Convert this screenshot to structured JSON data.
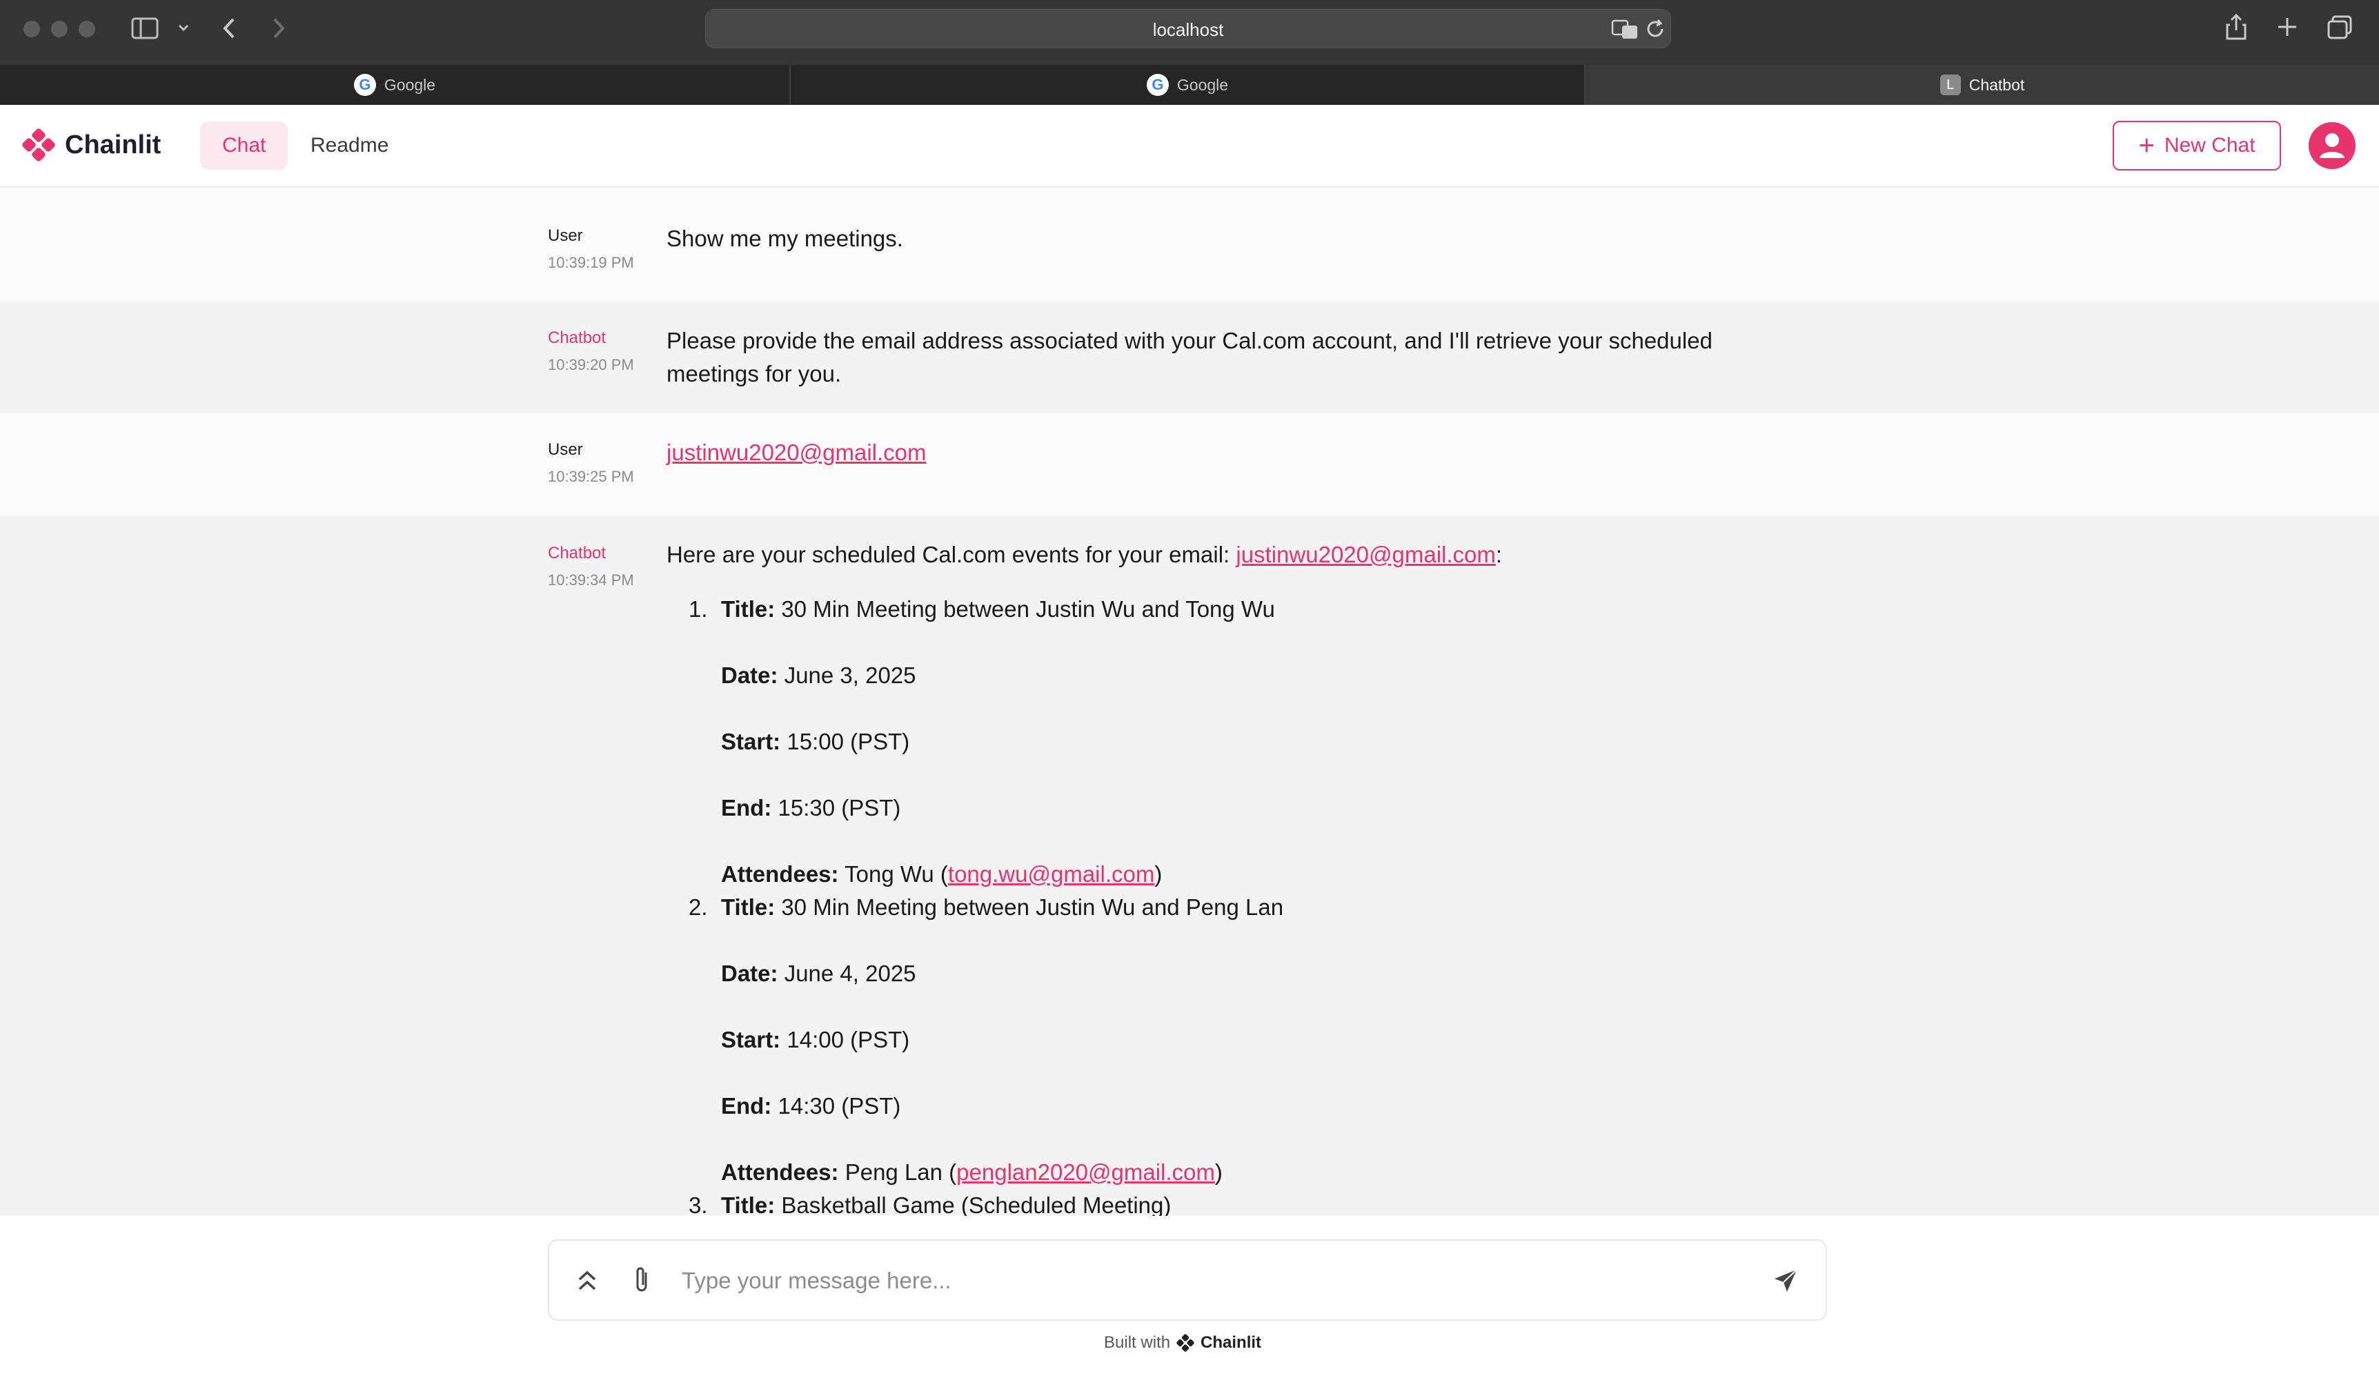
{
  "browser": {
    "url": "localhost",
    "tabs": [
      {
        "label": "Google",
        "icon": "google-icon"
      },
      {
        "label": "Google",
        "icon": "google-icon"
      },
      {
        "label": "Chatbot",
        "icon": "letter-l-icon",
        "icon_letter": "L"
      }
    ]
  },
  "header": {
    "brand": "Chainlit",
    "nav": {
      "chat": "Chat",
      "readme": "Readme"
    },
    "new_chat": "New Chat"
  },
  "messages": [
    {
      "author": "User",
      "time": "10:39:19 PM",
      "text": "Show me my meetings."
    },
    {
      "author": "Chatbot",
      "time": "10:39:20 PM",
      "line1": "Please provide the email address associated with your Cal.com account, and I'll retrieve your scheduled",
      "line2": "meetings for you."
    },
    {
      "author": "User",
      "time": "10:39:25 PM",
      "email": "justinwu2020@gmail.com"
    },
    {
      "author": "Chatbot",
      "time": "10:39:34 PM",
      "intro": "Here are your scheduled Cal.com events for your email: ",
      "intro_email": "justinwu2020@gmail.com",
      "intro_end": ":",
      "labels": {
        "title": "Title:",
        "date": "Date:",
        "start": "Start:",
        "end": "End:",
        "attendees": "Attendees:"
      },
      "events": [
        {
          "num": "1.",
          "title": "30 Min Meeting between Justin Wu and Tong Wu",
          "date": "June 3, 2025",
          "start": "15:00 (PST)",
          "end": "15:30 (PST)",
          "attendee_name": "Tong Wu (",
          "attendee_email": "tong.wu@gmail.com",
          "attendee_close": ")"
        },
        {
          "num": "2.",
          "title": "30 Min Meeting between Justin Wu and Peng Lan",
          "date": "June 4, 2025",
          "start": "14:00 (PST)",
          "end": "14:30 (PST)",
          "attendee_name": "Peng Lan (",
          "attendee_email": "penglan2020@gmail.com",
          "attendee_close": ")"
        },
        {
          "num": "3.",
          "title": "Basketball Game (Scheduled Meeting)"
        }
      ]
    }
  ],
  "composer": {
    "placeholder": "Type your message here..."
  },
  "footer": {
    "built_with": "Built with",
    "brand": "Chainlit"
  },
  "colors": {
    "accent": "#e8336d",
    "chrome": "#353535"
  }
}
